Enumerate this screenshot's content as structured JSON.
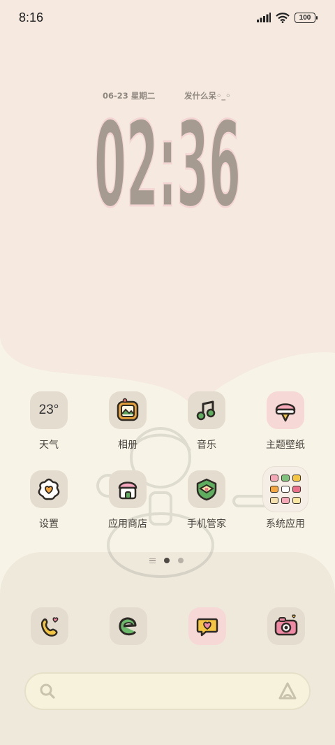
{
  "status_bar": {
    "time": "8:16",
    "battery": "100",
    "icons": [
      "signal-icon",
      "wifi-icon",
      "battery-icon"
    ]
  },
  "clock_widget": {
    "date": "06-23 星期二",
    "caption": "发什么呆◦_◦",
    "time": "02:36"
  },
  "apps": [
    {
      "label": "天气",
      "icon": "weather-icon",
      "temp": "23°"
    },
    {
      "label": "相册",
      "icon": "gallery-icon"
    },
    {
      "label": "音乐",
      "icon": "music-icon"
    },
    {
      "label": "主题壁纸",
      "icon": "themes-icon"
    },
    {
      "label": "设置",
      "icon": "settings-icon"
    },
    {
      "label": "应用商店",
      "icon": "app-store-icon"
    },
    {
      "label": "手机管家",
      "icon": "security-icon"
    },
    {
      "label": "系统应用",
      "icon": "system-apps-folder"
    }
  ],
  "page_indicator": {
    "pages": 2,
    "current": 1
  },
  "dock": [
    {
      "icon": "phone-icon"
    },
    {
      "icon": "browser-icon"
    },
    {
      "icon": "messages-icon"
    },
    {
      "icon": "camera-icon"
    }
  ],
  "search": {
    "icons": [
      "search-icon",
      "assistant-icon"
    ]
  },
  "colors": {
    "top_background": "#f5e9e0",
    "bottom_background": "#f7f3e6",
    "dock_background": "#efe9dc",
    "icon_tile": "#e5dcd0",
    "pink_tile": "#f6d9d6",
    "clock_digits": "#a59b90",
    "label_text": "#4a4540"
  }
}
